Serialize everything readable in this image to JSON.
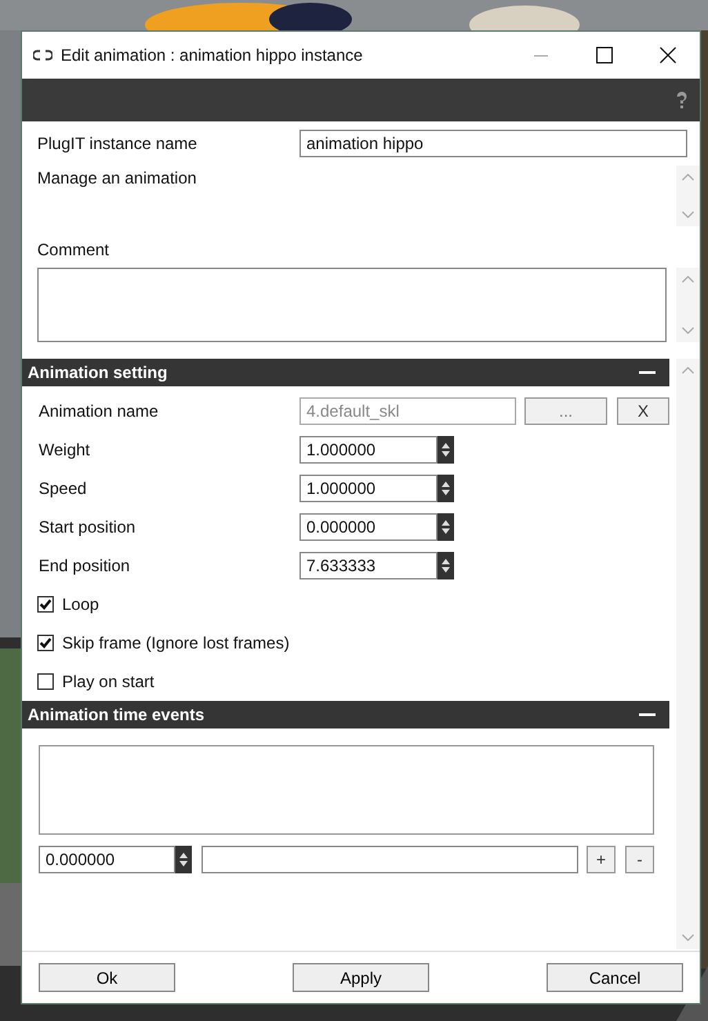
{
  "window": {
    "title": "Edit animation : animation hippo instance"
  },
  "instance": {
    "label": "PlugIT instance name",
    "value": "animation hippo"
  },
  "description": "Manage an animation",
  "comment": {
    "label": "Comment"
  },
  "sections": [
    {
      "title": "Animation setting",
      "expanded": true,
      "animation_name": {
        "label": "Animation name",
        "value": "4.default_skl",
        "disabled": true,
        "browse": "...",
        "clear": "X"
      },
      "numbers": [
        {
          "label": "Weight",
          "value": "1.000000"
        },
        {
          "label": "Speed",
          "value": "1.000000"
        },
        {
          "label": "Start position",
          "value": "0.000000"
        },
        {
          "label": "End position",
          "value": "7.633333"
        }
      ],
      "options": [
        {
          "label": "Loop",
          "checked": true
        },
        {
          "label": "Skip frame (Ignore lost frames)",
          "checked": true
        },
        {
          "label": "Play on start",
          "checked": false
        }
      ]
    },
    {
      "title": "Animation time events",
      "expanded": true,
      "event_time": "0.000000",
      "add": "+",
      "remove": "-"
    }
  ],
  "buttons": [
    "Ok",
    "Apply",
    "Cancel"
  ]
}
